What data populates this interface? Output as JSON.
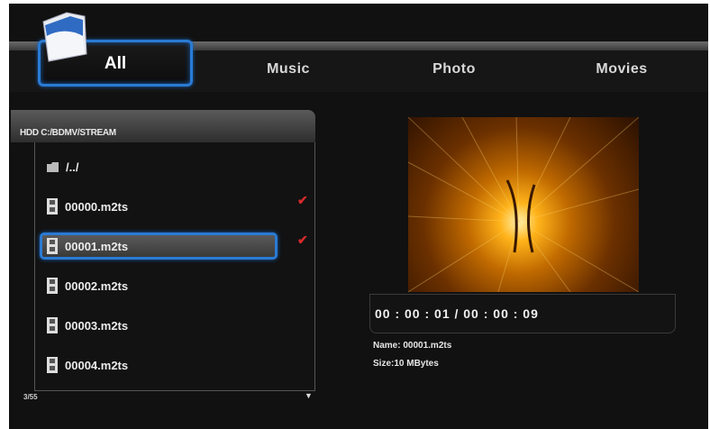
{
  "tabs": [
    {
      "label": "All"
    },
    {
      "label": "Music"
    },
    {
      "label": "Photo"
    },
    {
      "label": "Movies"
    }
  ],
  "browser": {
    "path": "HDD C:/BDMV/STREAM",
    "items": [
      {
        "label": "/../",
        "type": "folder",
        "checked": false
      },
      {
        "label": "00000.m2ts",
        "type": "video",
        "checked": true
      },
      {
        "label": "00001.m2ts",
        "type": "video",
        "checked": true
      },
      {
        "label": "00002.m2ts",
        "type": "video",
        "checked": false
      },
      {
        "label": "00003.m2ts",
        "type": "video",
        "checked": false
      },
      {
        "label": "00004.m2ts",
        "type": "video",
        "checked": false
      }
    ],
    "counter": "3/55",
    "check_mark": "✔",
    "scroll_down": "▼"
  },
  "preview": {
    "time": "00 : 00 : 01 / 00 : 00 : 09",
    "name": "Name: 00001.m2ts",
    "size": "Size:10 MBytes"
  },
  "colors": {
    "accent": "#2a7bd4",
    "check": "#d62a2a",
    "background": "#111111"
  }
}
